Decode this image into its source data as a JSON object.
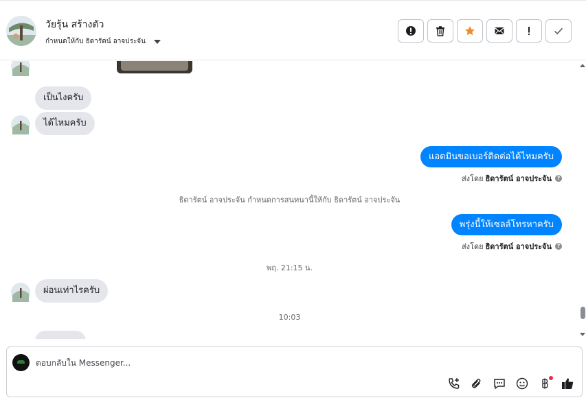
{
  "header": {
    "contact_name": "วัยรุ้น สร้างตัว",
    "assigned_label": "กำหนดให้กับ ธิดารัตน์ อาจประจัน",
    "actions": [
      {
        "name": "report-spam-button",
        "icon": "alert-circle-icon"
      },
      {
        "name": "delete-button",
        "icon": "trash-icon"
      },
      {
        "name": "star-button",
        "icon": "star-icon"
      },
      {
        "name": "mark-unread-button",
        "icon": "envelope-icon"
      },
      {
        "name": "follow-up-button",
        "icon": "exclamation-icon"
      },
      {
        "name": "mark-done-button",
        "icon": "checkmark-icon"
      }
    ]
  },
  "colors": {
    "outgoing_bubble": "#0084ff",
    "incoming_bubble": "#e4e6eb",
    "star": "#f28c28",
    "notification_dot": "#f02849"
  },
  "messages": {
    "m1": "เป็นไงครับ",
    "m2": "ได้ไหมครับ",
    "m3": "แอดมินขอเบอร์ติดต่อได้ไหมครับ",
    "m3_sent_prefix": "ส่งโดย",
    "m3_sent_by": "ธิดารัตน์ อาจประจัน",
    "assign_note": "ธิดารัตน์ อาจประจัน กำหนดการสนทนานี้ให้กับ ธิดารัตน์ อาจประจัน",
    "m4": "พรุ่งนี้ให้เซลล์โทรหาครับ",
    "m4_sent_prefix": "ส่งโดย",
    "m4_sent_by": "ธิดารัตน์ อาจประจัน",
    "timestamp1": "พฤ. 21:15 น.",
    "m5": "ผ่อนเท่าไรครับ",
    "timestamp2": "10:03"
  },
  "composer": {
    "placeholder": "ตอบกลับใน Messenger...",
    "tools": [
      "add-call-icon",
      "paperclip-icon",
      "saved-replies-icon",
      "emoji-icon",
      "baht-payment-icon",
      "like-icon"
    ]
  }
}
